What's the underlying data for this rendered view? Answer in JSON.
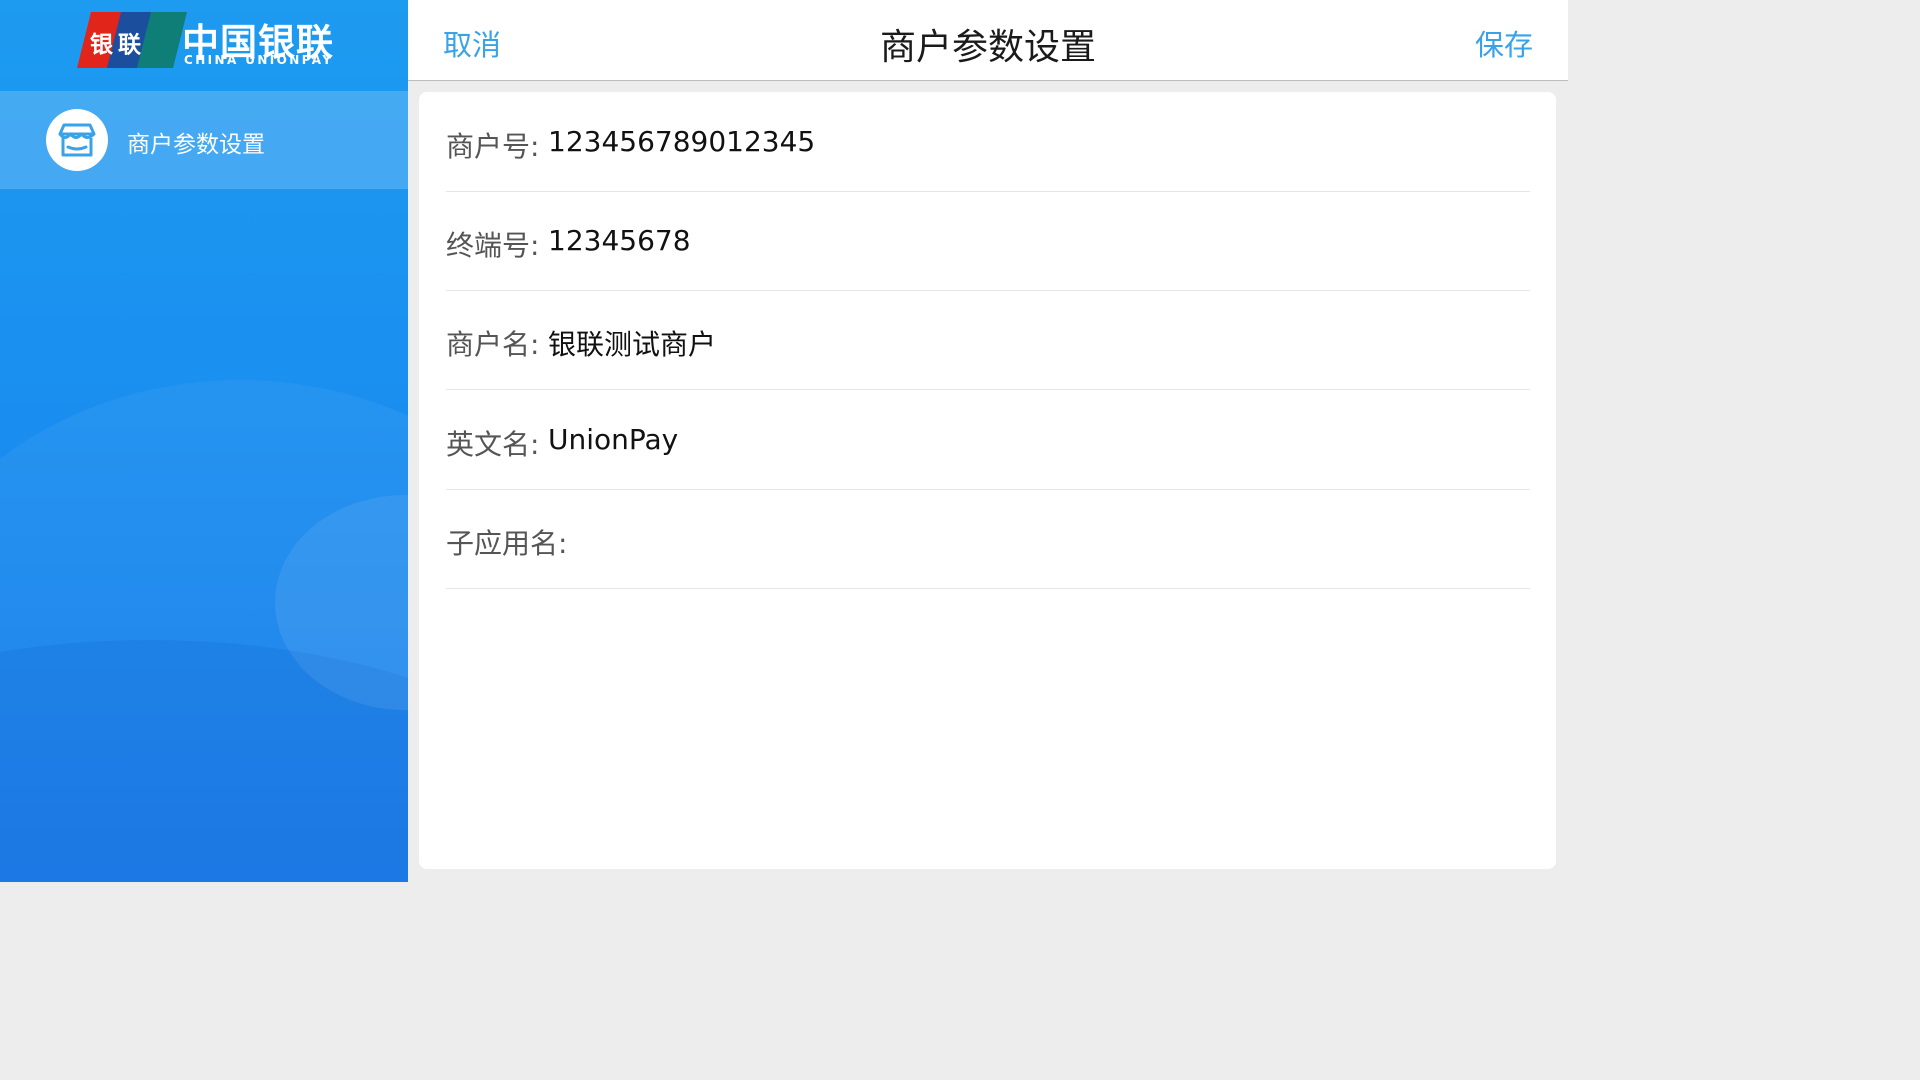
{
  "sidebar": {
    "logo": {
      "card_text": "银联",
      "name_cn": "中国银联",
      "name_en": "CHINA UNIONPAY"
    },
    "items": [
      {
        "label": "商户参数设置",
        "icon": "store-icon",
        "selected": true
      }
    ]
  },
  "header": {
    "cancel_label": "取消",
    "title": "商户参数设置",
    "save_label": "保存"
  },
  "form": {
    "fields": [
      {
        "label": "商户号:",
        "value": "123456789012345"
      },
      {
        "label": "终端号:",
        "value": "12345678"
      },
      {
        "label": "商户名:",
        "value": "银联测试商户"
      },
      {
        "label": "英文名:",
        "value": "UnionPay"
      },
      {
        "label": "子应用名:",
        "value": ""
      }
    ]
  },
  "colors": {
    "accent": "#3aa2e8",
    "sidebar_blue": "#1a8ff0",
    "unionpay_red": "#e1251b",
    "unionpay_blue": "#1c4e9e",
    "unionpay_teal": "#0e7e77"
  }
}
